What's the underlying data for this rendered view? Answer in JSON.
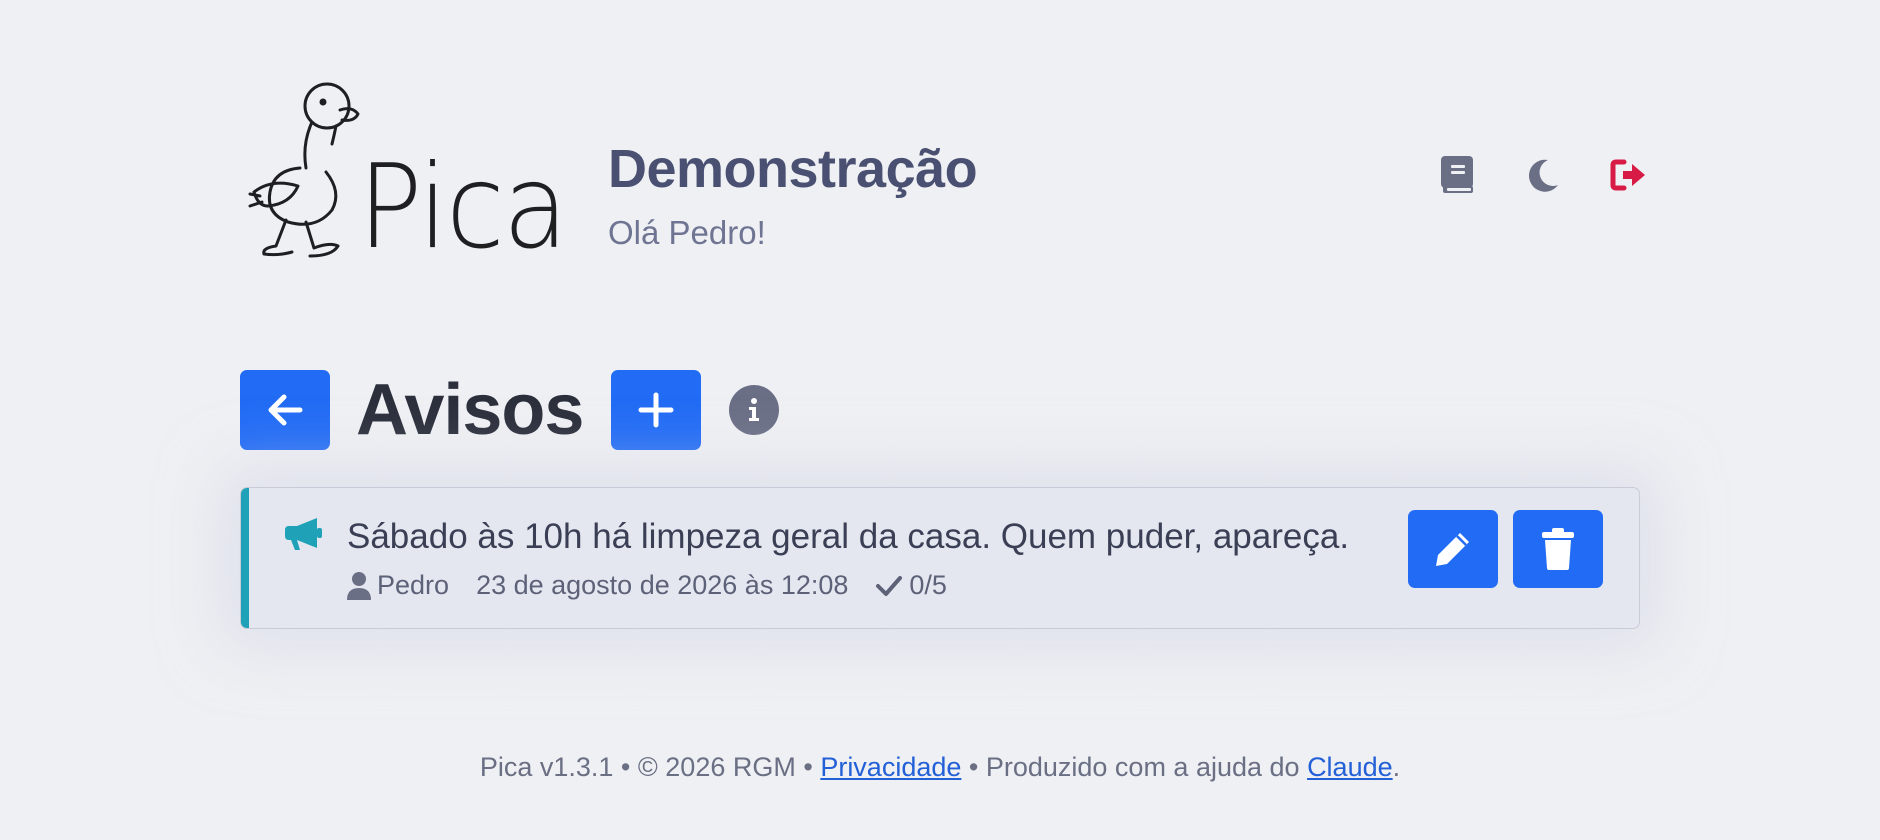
{
  "header": {
    "logo_text": "Pica",
    "app_title": "Demonstração",
    "greeting": "Olá Pedro!",
    "icons": [
      {
        "name": "book-icon",
        "color": "#6b6f86"
      },
      {
        "name": "moon-icon",
        "color": "#6b6f86"
      },
      {
        "name": "logout-icon",
        "color": "#d81b44"
      }
    ]
  },
  "section": {
    "back_icon": "arrow-left-icon",
    "title": "Avisos",
    "add_icon": "plus-icon",
    "info_icon": "info-icon"
  },
  "notices": [
    {
      "icon": "megaphone-icon",
      "text": "Sábado às 10h há limpeza geral da casa. Quem puder, apareça.",
      "author": "Pedro",
      "date": "23 de agosto de 2026 às 12:08",
      "confirmations": "0/5",
      "accent_color": "#1fa2b8"
    }
  ],
  "footer": {
    "prefix": "Pica v1.3.1 • © 2026 RGM • ",
    "privacy_link": "Privacidade",
    "middle": " • Produzido com a ajuda do ",
    "claude_link": "Claude",
    "suffix": "."
  },
  "colors": {
    "primary": "#226cf5",
    "background": "#eff0f4",
    "card": "#e4e7ef",
    "danger": "#d81b44"
  }
}
